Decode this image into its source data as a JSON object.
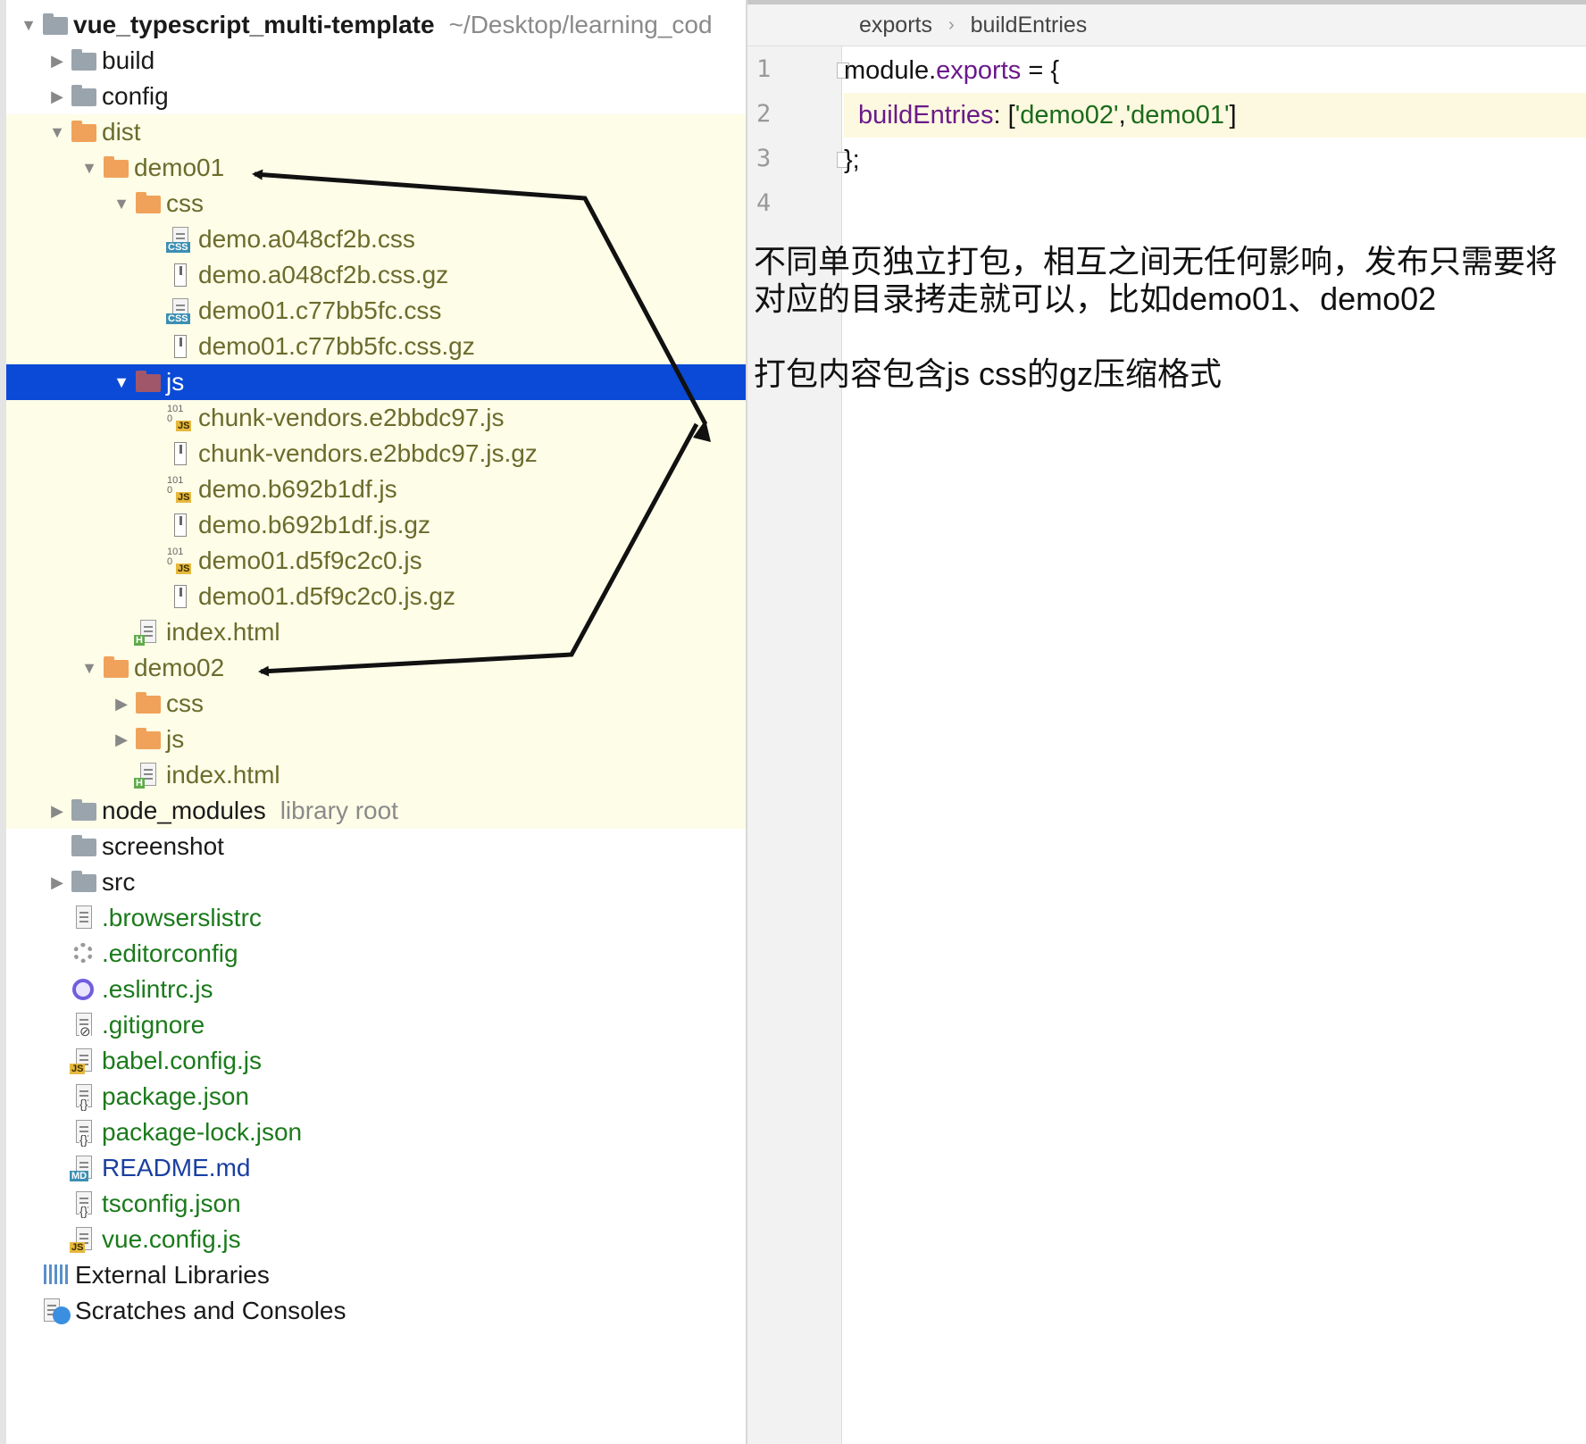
{
  "project_tree": {
    "root": {
      "name": "vue_typescript_multi-template",
      "path": "~/Desktop/learning_cod"
    },
    "rows": [
      {
        "label": "build",
        "type": "folder",
        "color": "gray",
        "toggle": "▶"
      },
      {
        "label": "config",
        "type": "folder",
        "color": "gray",
        "toggle": "▶"
      },
      {
        "label": "dist",
        "type": "folder",
        "color": "orange",
        "toggle": "▼"
      },
      {
        "label": "demo01",
        "type": "folder",
        "color": "orange",
        "toggle": "▼"
      },
      {
        "label": "css",
        "type": "folder",
        "color": "orange",
        "toggle": "▼"
      },
      {
        "label": "demo.a048cf2b.css",
        "type": "css-file"
      },
      {
        "label": "demo.a048cf2b.css.gz",
        "type": "gz-file"
      },
      {
        "label": "demo01.c77bb5fc.css",
        "type": "css-file"
      },
      {
        "label": "demo01.c77bb5fc.css.gz",
        "type": "gz-file"
      },
      {
        "label": "js",
        "type": "folder",
        "color": "maroon",
        "toggle": "▼",
        "selected": true
      },
      {
        "label": "chunk-vendors.e2bbdc97.js",
        "type": "js-bin-file"
      },
      {
        "label": "chunk-vendors.e2bbdc97.js.gz",
        "type": "gz-file"
      },
      {
        "label": "demo.b692b1df.js",
        "type": "js-bin-file"
      },
      {
        "label": "demo.b692b1df.js.gz",
        "type": "gz-file"
      },
      {
        "label": "demo01.d5f9c2c0.js",
        "type": "js-bin-file"
      },
      {
        "label": "demo01.d5f9c2c0.js.gz",
        "type": "gz-file"
      },
      {
        "label": "index.html",
        "type": "html-file"
      },
      {
        "label": "demo02",
        "type": "folder",
        "color": "orange",
        "toggle": "▼"
      },
      {
        "label": "css",
        "type": "folder",
        "color": "orange",
        "toggle": "▶"
      },
      {
        "label": "js",
        "type": "folder",
        "color": "orange",
        "toggle": "▶"
      },
      {
        "label": "index.html",
        "type": "html-file"
      },
      {
        "label": "node_modules",
        "type": "folder",
        "color": "gray",
        "toggle": "▶",
        "hint": "library root"
      },
      {
        "label": "screenshot",
        "type": "folder",
        "color": "gray"
      },
      {
        "label": "src",
        "type": "folder",
        "color": "gray",
        "toggle": "▶"
      },
      {
        "label": ".browserslistrc",
        "type": "text-file"
      },
      {
        "label": ".editorconfig",
        "type": "gear-file"
      },
      {
        "label": ".eslintrc.js",
        "type": "eslint-file"
      },
      {
        "label": ".gitignore",
        "type": "ignore-file"
      },
      {
        "label": "babel.config.js",
        "type": "js-file"
      },
      {
        "label": "package.json",
        "type": "json-file"
      },
      {
        "label": "package-lock.json",
        "type": "json-file"
      },
      {
        "label": "README.md",
        "type": "md-file"
      },
      {
        "label": "tsconfig.json",
        "type": "json-file"
      },
      {
        "label": "vue.config.js",
        "type": "js-file"
      },
      {
        "label": "External Libraries",
        "type": "libraries"
      },
      {
        "label": "Scratches and Consoles",
        "type": "scratches"
      }
    ]
  },
  "editor": {
    "breadcrumb": [
      "exports",
      "buildEntries"
    ],
    "line_numbers": [
      "1",
      "2",
      "3",
      "4"
    ],
    "code": {
      "l1_a": "module.",
      "l1_b": "exports",
      "l1_c": " = {",
      "l2_key": "buildEntries",
      "l2_colon": ": [",
      "l2_s1": "'demo02'",
      "l2_comma": ",",
      "l2_s2": "'demo01'",
      "l2_end": "]",
      "l3": "};"
    },
    "notes": [
      "不同单页独立打包，相互之间无任何影响，发布只需要将对应的目录拷走就可以，比如demo01、demo02",
      "打包内容包含js css的gz压缩格式"
    ]
  },
  "colors": {
    "selection": "#0b4ad6",
    "dist_highlight": "#fdfde8",
    "string_green": "#1b6b1b",
    "property_purple": "#6a1a8a"
  }
}
